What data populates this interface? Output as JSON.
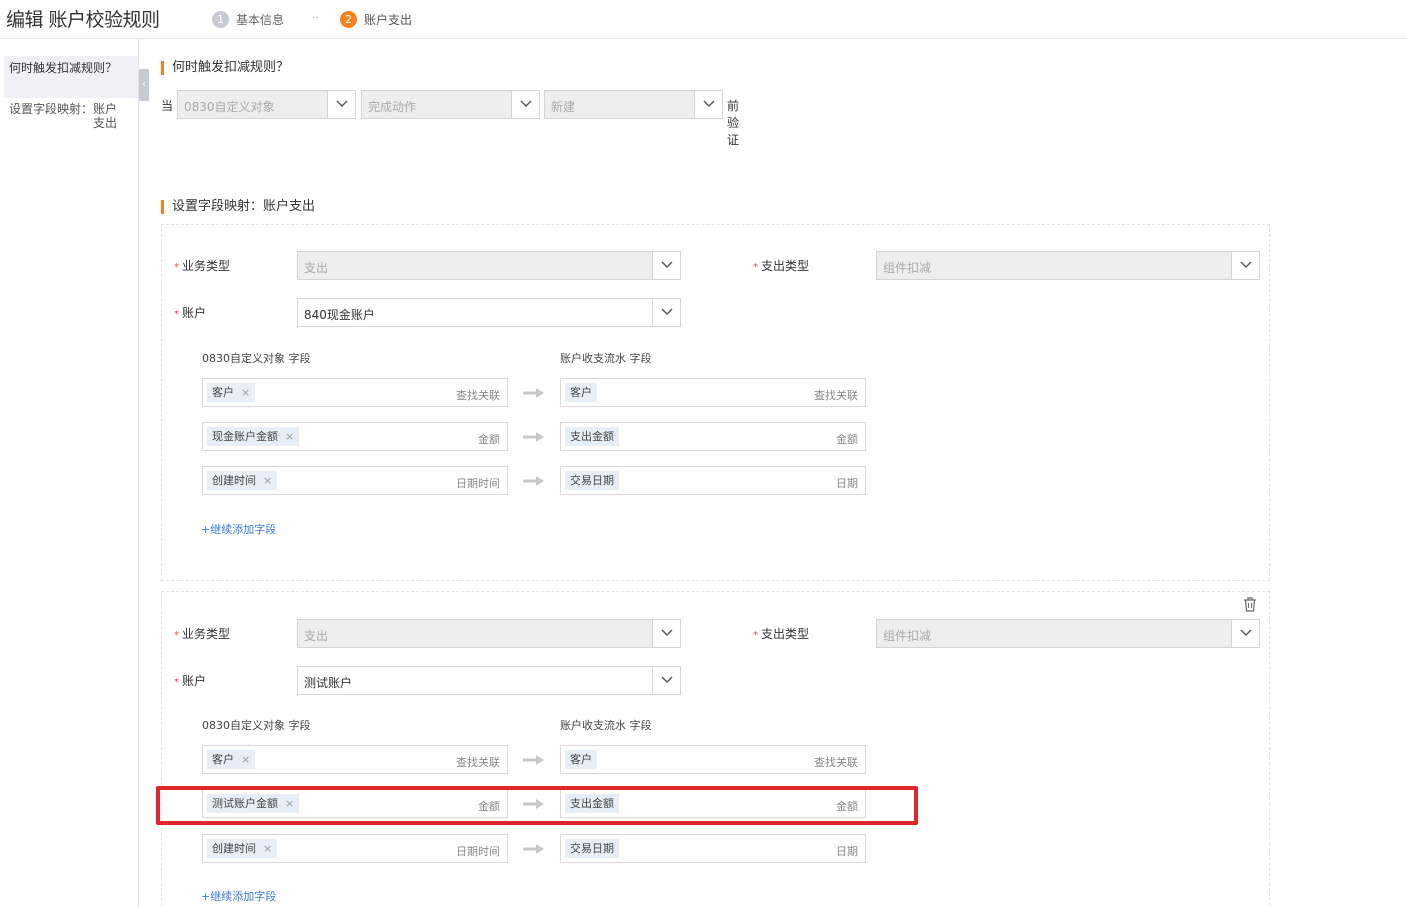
{
  "header": {
    "title": "编辑 账户校验规则",
    "steps": [
      {
        "num": "1",
        "label": "基本信息"
      },
      {
        "num": "2",
        "label": "账户支出"
      }
    ],
    "separator": "··"
  },
  "sidebar": {
    "items": [
      {
        "label": "何时触发扣减规则？"
      },
      {
        "label": "设置字段映射：账户支出"
      }
    ]
  },
  "trigger": {
    "section_title": "何时触发扣减规则？",
    "prefix": "当",
    "object_select": "0830自定义对象",
    "action_select": "完成动作",
    "event_select": "新建",
    "suffix": "前验证"
  },
  "mapping": {
    "section_title": "设置字段映射：账户支出",
    "cards": [
      {
        "business_type_label": "业务类型",
        "business_type_value": "支出",
        "expense_type_label": "支出类型",
        "expense_type_value": "组件扣减",
        "account_label": "账户",
        "account_value": "840现金账户",
        "source_header": "0830自定义对象 字段",
        "target_header": "账户收支流水 字段",
        "rows": [
          {
            "source_tag": "客户",
            "source_hint": "查找关联",
            "target_tag": "客户",
            "target_hint": "查找关联"
          },
          {
            "source_tag": "现金账户金额",
            "source_hint": "金额",
            "target_tag": "支出金额",
            "target_hint": "金额"
          },
          {
            "source_tag": "创建时间",
            "source_hint": "日期时间",
            "target_tag": "交易日期",
            "target_hint": "日期"
          }
        ],
        "add_label": "+继续添加字段"
      },
      {
        "business_type_label": "业务类型",
        "business_type_value": "支出",
        "expense_type_label": "支出类型",
        "expense_type_value": "组件扣减",
        "account_label": "账户",
        "account_value": "测试账户",
        "source_header": "0830自定义对象 字段",
        "target_header": "账户收支流水 字段",
        "rows": [
          {
            "source_tag": "客户",
            "source_hint": "查找关联",
            "target_tag": "客户",
            "target_hint": "查找关联"
          },
          {
            "source_tag": "测试账户金额",
            "source_hint": "金额",
            "target_tag": "支出金额",
            "target_hint": "金额"
          },
          {
            "source_tag": "创建时间",
            "source_hint": "日期时间",
            "target_tag": "交易日期",
            "target_hint": "日期"
          }
        ],
        "add_label": "+继续添加字段"
      }
    ]
  },
  "tag_remove_glyph": "×",
  "required_mark": "*",
  "colors": {
    "accent": "#f5821f",
    "link": "#3a7bd5",
    "highlight": "#e0262b",
    "tag_bg": "#e7eef8"
  }
}
